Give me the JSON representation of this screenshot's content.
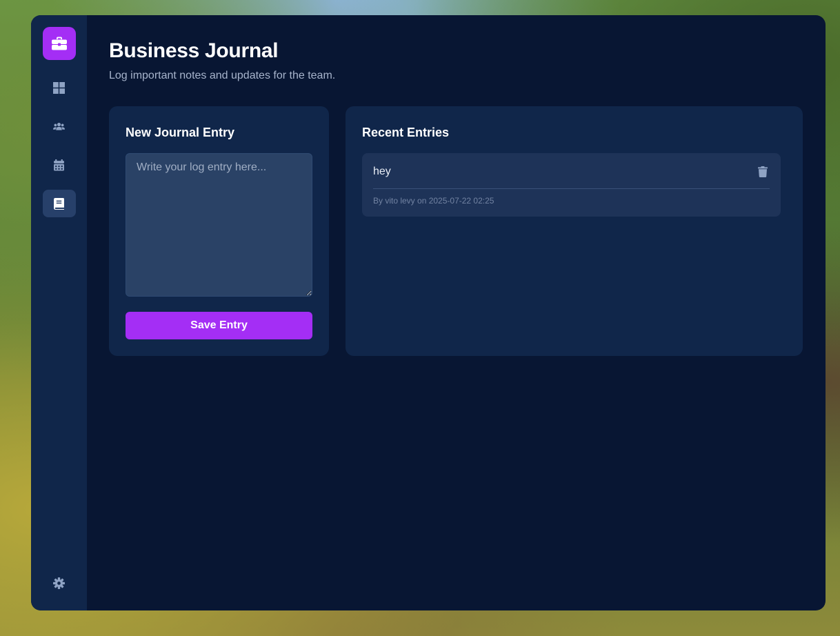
{
  "colors": {
    "window_bg": "#081633",
    "sidebar_bg": "#10264a",
    "panel_bg": "#10264a",
    "accent": "#a42ef5",
    "textarea_bg": "#2a4266",
    "entry_card_bg": "#1e3358"
  },
  "sidebar": {
    "logo_icon": "briefcase-icon",
    "items": [
      {
        "icon": "dashboard-grid-icon",
        "active": false
      },
      {
        "icon": "users-icon",
        "active": false
      },
      {
        "icon": "calendar-icon",
        "active": false
      },
      {
        "icon": "journal-book-icon",
        "active": true
      }
    ],
    "settings_icon": "gear-icon"
  },
  "header": {
    "title": "Business Journal",
    "subtitle": "Log important notes and updates for the team."
  },
  "new_entry": {
    "title": "New Journal Entry",
    "placeholder": "Write your log entry here...",
    "value": "",
    "save_label": "Save Entry"
  },
  "recent": {
    "title": "Recent Entries",
    "entries": [
      {
        "text": "hey",
        "meta": "By vito levy on 2025-07-22 02:25",
        "delete_icon": "trash-icon"
      }
    ]
  }
}
